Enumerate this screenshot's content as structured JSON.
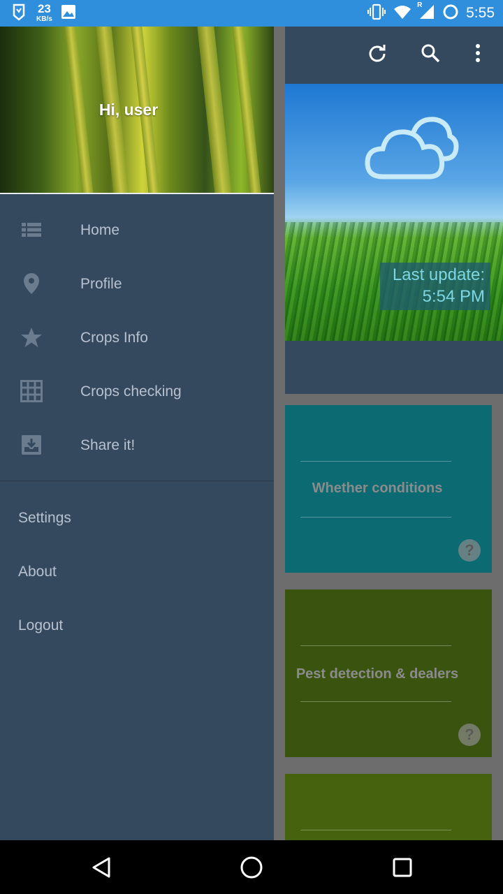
{
  "status_bar": {
    "speed_value": "23",
    "speed_unit": "KB/s",
    "network_label": "R",
    "time": "5:55"
  },
  "drawer": {
    "greeting": "Hi, user",
    "menu": [
      {
        "label": "Home",
        "icon": "list-icon"
      },
      {
        "label": "Profile",
        "icon": "location-pin-icon"
      },
      {
        "label": "Crops Info",
        "icon": "star-icon"
      },
      {
        "label": "Crops checking",
        "icon": "grid-icon"
      },
      {
        "label": "Share it!",
        "icon": "download-box-icon"
      }
    ],
    "secondary": [
      {
        "label": "Settings"
      },
      {
        "label": "About"
      },
      {
        "label": "Logout"
      }
    ]
  },
  "app": {
    "actions": [
      "refresh-icon",
      "search-icon",
      "more-vert-icon"
    ],
    "weather_icon": "cloud-icon",
    "last_update_label": "Last update:",
    "last_update_time": "5:54 PM",
    "cards": [
      {
        "title": "Whether conditions",
        "color": "#0c6a73"
      },
      {
        "title": "Pest detection & dealers",
        "color": "#3a5410"
      },
      {
        "title": "",
        "color": "#47620f"
      }
    ]
  },
  "colors": {
    "status_bar": "#2f8fdc",
    "drawer_bg": "#34495e",
    "menu_text": "#b7c1cf",
    "scrim": "#6d6d6d"
  }
}
